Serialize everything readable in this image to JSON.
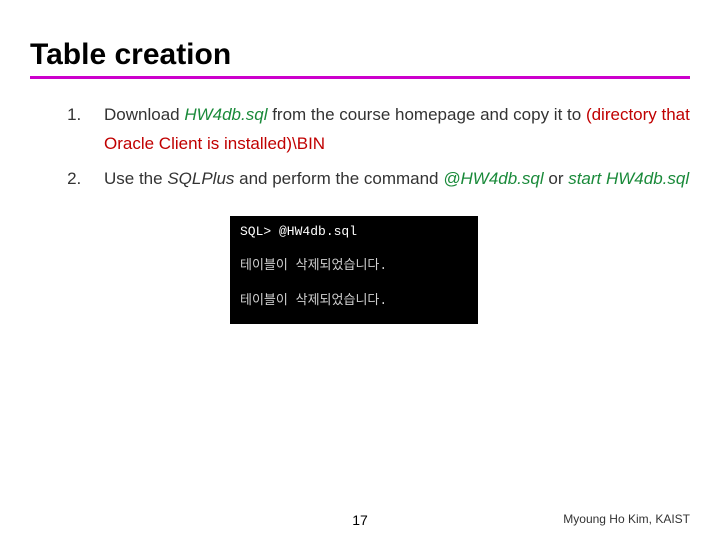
{
  "title": "Table creation",
  "list": {
    "item1": {
      "prefix": "Download ",
      "hw_file": "HW4db.sql",
      "mid": " from the course homepage and copy it to ",
      "red_path": "(directory that Oracle Client is installed)\\BIN"
    },
    "item2": {
      "prefix": "Use the ",
      "sqlplus": "SQLPlus",
      "mid": " and perform the command ",
      "cmd1": "@HW4db.sql",
      "or": " or ",
      "cmd2": "start HW4db.sql"
    }
  },
  "terminal": {
    "prompt": "SQL> @HW4db.sql",
    "line1": "테이블이 삭제되었습니다.",
    "line2": "테이블이 삭제되었습니다."
  },
  "page_number": "17",
  "author": "Myoung Ho Kim, KAIST"
}
